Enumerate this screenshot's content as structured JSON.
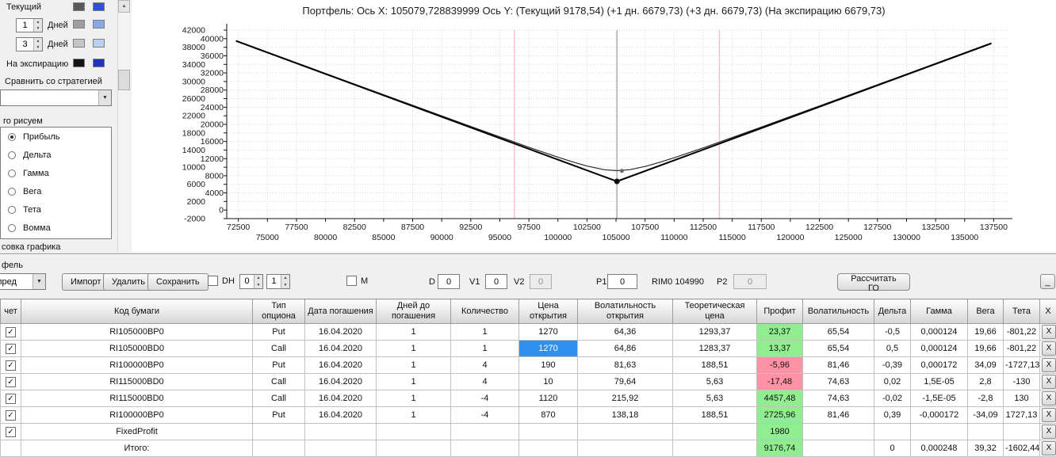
{
  "sidebar": {
    "rows": [
      {
        "label": "Текущий",
        "colors": [
          "#595959",
          "#3050d8"
        ]
      },
      {
        "value": "1",
        "label": "Дней",
        "colors": [
          "#9f9f9f",
          "#88a8e8"
        ]
      },
      {
        "value": "3",
        "label": "Дней",
        "colors": [
          "#c6c6c6",
          "#b6d2f0"
        ]
      },
      {
        "label": "На экспирацию",
        "colors": [
          "#141414",
          "#2030c0"
        ]
      }
    ],
    "compare_label": "Сравнить со стратегией",
    "draw_group_label": "го рисуем",
    "draw_items": [
      "Прибыль",
      "Дельта",
      "Гамма",
      "Вега",
      "Тета",
      "Вомма"
    ],
    "bottom_label": "совка графика"
  },
  "chart": {
    "title": "Портфель: Ось X: 105079,728839999 Ось Y:  (Текущий 9178,54)  (+1 дн. 6679,73)  (+3 дн. 6679,73)  (На экспирацию 6679,73)"
  },
  "chart_data": {
    "type": "line",
    "title": "Портфель",
    "x_range": [
      71500,
      138700
    ],
    "y_range": [
      -2000,
      42000
    ],
    "x_ticks": [
      72500,
      75000,
      77500,
      80000,
      82500,
      85000,
      87500,
      90000,
      92500,
      95000,
      97500,
      100000,
      102500,
      105000,
      107500,
      110000,
      112500,
      115000,
      117500,
      120000,
      122500,
      125000,
      127500,
      130000,
      132500,
      135000,
      137500
    ],
    "y_ticks": [
      -2000,
      0,
      2000,
      4000,
      6000,
      8000,
      10000,
      12000,
      14000,
      16000,
      18000,
      20000,
      22000,
      24000,
      26000,
      28000,
      30000,
      32000,
      34000,
      36000,
      38000,
      40000,
      42000
    ],
    "crosshair_x": 105079.728839999,
    "values_at_crosshair": {
      "current": 9178.54,
      "plus1d": 6679.73,
      "plus3d": 6679.73,
      "expiration": 6679.73
    },
    "vlines": [
      {
        "x": 96250,
        "color": "#f0c2cb",
        "width": 1.5
      },
      {
        "x": 113900,
        "color": "#f0c2cb",
        "width": 1.5
      },
      {
        "x": 105079,
        "color": "#8c8c8c",
        "width": 1
      }
    ],
    "series": [
      {
        "name": "Текущий",
        "color": "#2a2a2a",
        "width": 1.2,
        "points": [
          [
            72300,
            39554
          ],
          [
            77500,
            34372
          ],
          [
            82500,
            29397
          ],
          [
            87500,
            24436
          ],
          [
            92500,
            19505
          ],
          [
            97500,
            14661
          ],
          [
            100000,
            12341
          ],
          [
            101500,
            11046
          ],
          [
            102500,
            10272
          ],
          [
            104000,
            9402
          ],
          [
            105079,
            9180
          ],
          [
            106200,
            9420
          ],
          [
            107500,
            10160
          ],
          [
            108700,
            11080
          ],
          [
            110000,
            12200
          ],
          [
            112500,
            14511
          ],
          [
            117500,
            19350
          ],
          [
            122500,
            24280
          ],
          [
            127500,
            29240
          ],
          [
            132500,
            34215
          ],
          [
            137300,
            38998
          ]
        ]
      },
      {
        "name": "На экспирацию",
        "color": "#000000",
        "width": 2,
        "points": [
          [
            72300,
            39459
          ],
          [
            105079,
            6680
          ],
          [
            137300,
            38901
          ]
        ]
      }
    ],
    "markers": [
      {
        "x": 105500,
        "y": 9150,
        "r": 2.5,
        "fill": "#6a6a6a"
      },
      {
        "x": 105079,
        "y": 6680,
        "r": 3.5,
        "fill": "#0a0a0a"
      }
    ]
  },
  "toolbar": {
    "group_label": "фель",
    "combo_value": "спред",
    "import": "Импорт",
    "delete": "Удалить",
    "save": "Сохранить",
    "dh_label": "DH",
    "spin1": "0",
    "spin2": "1",
    "m_label": "M",
    "d_label": "D",
    "d_value": "0",
    "v1_label": "V1",
    "v1_value": "0",
    "v2_label": "V2",
    "v2_value": "0",
    "p1_label": "P1",
    "p1_value": "0",
    "instrument": "RIM0 104990",
    "p2_label": "P2",
    "p2_value": "0",
    "calc_go": "Рассчитать ГО",
    "minimize": "_"
  },
  "table": {
    "delete_label": "X",
    "headers": [
      "чет",
      "Код бумаги",
      "Тип опциона",
      "Дата погашения",
      "Дней до погашения",
      "Количество",
      "Цена открытия",
      "Волатильность открытия",
      "Теоретическая цена",
      "Профит",
      "Волатильность",
      "Дельта",
      "Гамма",
      "Вега",
      "Тета",
      "X"
    ],
    "rows": [
      {
        "checked": true,
        "profit": "positive",
        "cells": [
          "RI105000BP0",
          "Put",
          "16.04.2020",
          "1",
          "1",
          "1270",
          "64,36",
          "1293,37",
          "23,37",
          "65,54",
          "-0,5",
          "0,000124",
          "19,66",
          "-801,22"
        ]
      },
      {
        "checked": true,
        "profit": "positive",
        "price_selected": true,
        "cells": [
          "RI105000BD0",
          "Call",
          "16.04.2020",
          "1",
          "1",
          "1270",
          "64,86",
          "1283,37",
          "13,37",
          "65,54",
          "0,5",
          "0,000124",
          "19,66",
          "-801,22"
        ]
      },
      {
        "checked": true,
        "profit": "negative",
        "cells": [
          "RI100000BP0",
          "Put",
          "16.04.2020",
          "1",
          "4",
          "190",
          "81,63",
          "188,51",
          "-5,96",
          "81,46",
          "-0,39",
          "0,000172",
          "34,09",
          "-1727,13"
        ]
      },
      {
        "checked": true,
        "profit": "negative",
        "cells": [
          "RI115000BD0",
          "Call",
          "16.04.2020",
          "1",
          "4",
          "10",
          "79,64",
          "5,63",
          "-17,48",
          "74,63",
          "0,02",
          "1,5E-05",
          "2,8",
          "-130"
        ]
      },
      {
        "checked": true,
        "profit": "positive",
        "cells": [
          "RI115000BD0",
          "Call",
          "16.04.2020",
          "1",
          "-4",
          "1120",
          "215,92",
          "5,63",
          "4457,48",
          "74,63",
          "-0,02",
          "-1,5E-05",
          "-2,8",
          "130"
        ]
      },
      {
        "checked": true,
        "profit": "positive",
        "cells": [
          "RI100000BP0",
          "Put",
          "16.04.2020",
          "1",
          "-4",
          "870",
          "138,18",
          "188,51",
          "2725,96",
          "81,46",
          "0,39",
          "-0,000172",
          "-34,09",
          "1727,13"
        ]
      },
      {
        "checked": true,
        "profit": "positive",
        "cells": [
          "FixedProfit",
          "",
          "",
          "",
          "",
          "",
          "",
          "",
          "1980",
          "",
          "",
          "",
          "",
          ""
        ]
      },
      {
        "checked": null,
        "profit": "positive",
        "cells": [
          "Итого:",
          "",
          "",
          "",
          "",
          "",
          "",
          "",
          "9176,74",
          "",
          "0",
          "0,000248",
          "39,32",
          "-1602,44"
        ]
      }
    ]
  }
}
